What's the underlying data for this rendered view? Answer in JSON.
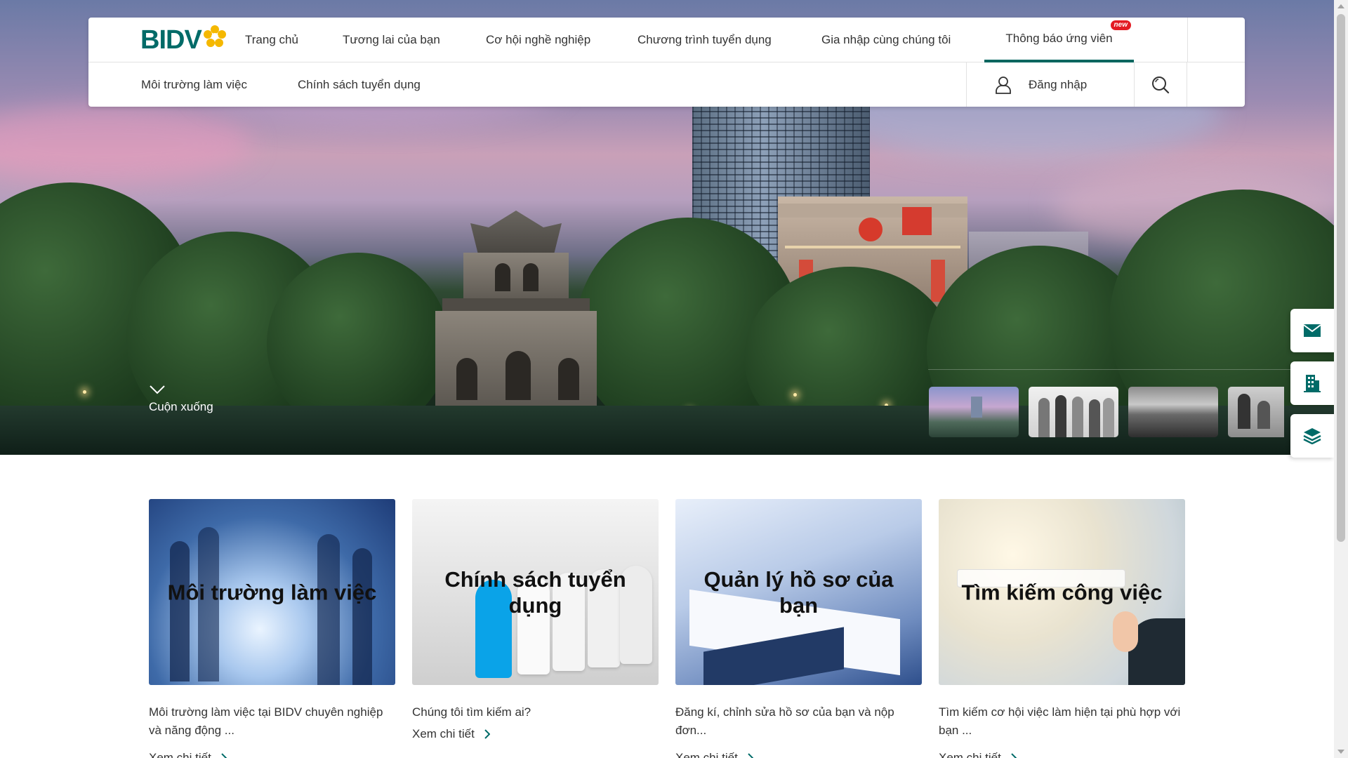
{
  "nav": {
    "logo_text": "BIDV",
    "menu": [
      {
        "label": "Trang chủ"
      },
      {
        "label": "Tương lai của bạn"
      },
      {
        "label": "Cơ hội nghề nghiệp"
      },
      {
        "label": "Chương trình tuyển dụng"
      },
      {
        "label": "Gia nhập cùng chúng tôi"
      },
      {
        "label": "Thông báo ứng viên",
        "active": true,
        "badge": "new"
      }
    ],
    "submenu": [
      {
        "label": "Môi trường làm việc"
      },
      {
        "label": "Chính sách tuyển dụng"
      }
    ],
    "login_label": "Đăng nhập",
    "search_icon": "search-icon",
    "user_icon": "user-icon"
  },
  "hero": {
    "scroll_label": "Cuộn xuống",
    "thumbnails": [
      "lake-city-thumb",
      "team-thumb",
      "landscape-thumb",
      "meeting-thumb"
    ]
  },
  "side_buttons": [
    {
      "icon": "mail-icon"
    },
    {
      "icon": "building-icon"
    },
    {
      "icon": "layers-icon"
    }
  ],
  "cards": [
    {
      "title": "Môi trường làm việc",
      "description": "Môi trường làm việc tại BIDV chuyên nghiệp và năng động ...",
      "link": "Xem chi tiết"
    },
    {
      "title": "Chính sách tuyển dụng",
      "description": "Chúng tôi tìm kiếm ai?",
      "link": "Xem chi tiết"
    },
    {
      "title": "Quản lý hồ sơ của bạn",
      "description": "Đăng kí, chỉnh sửa hồ sơ của bạn và nộp đơn...",
      "link": "Xem chi tiết"
    },
    {
      "title": "Tìm kiếm công việc",
      "description": "Tìm kiếm cơ hội việc làm hiện tại phù hợp với bạn ...",
      "link": "Xem chi tiết"
    }
  ],
  "colors": {
    "brand": "#006b68",
    "active_underline": "#00665f",
    "badge": "#e31b23",
    "logo_flower": "#f5b800"
  }
}
